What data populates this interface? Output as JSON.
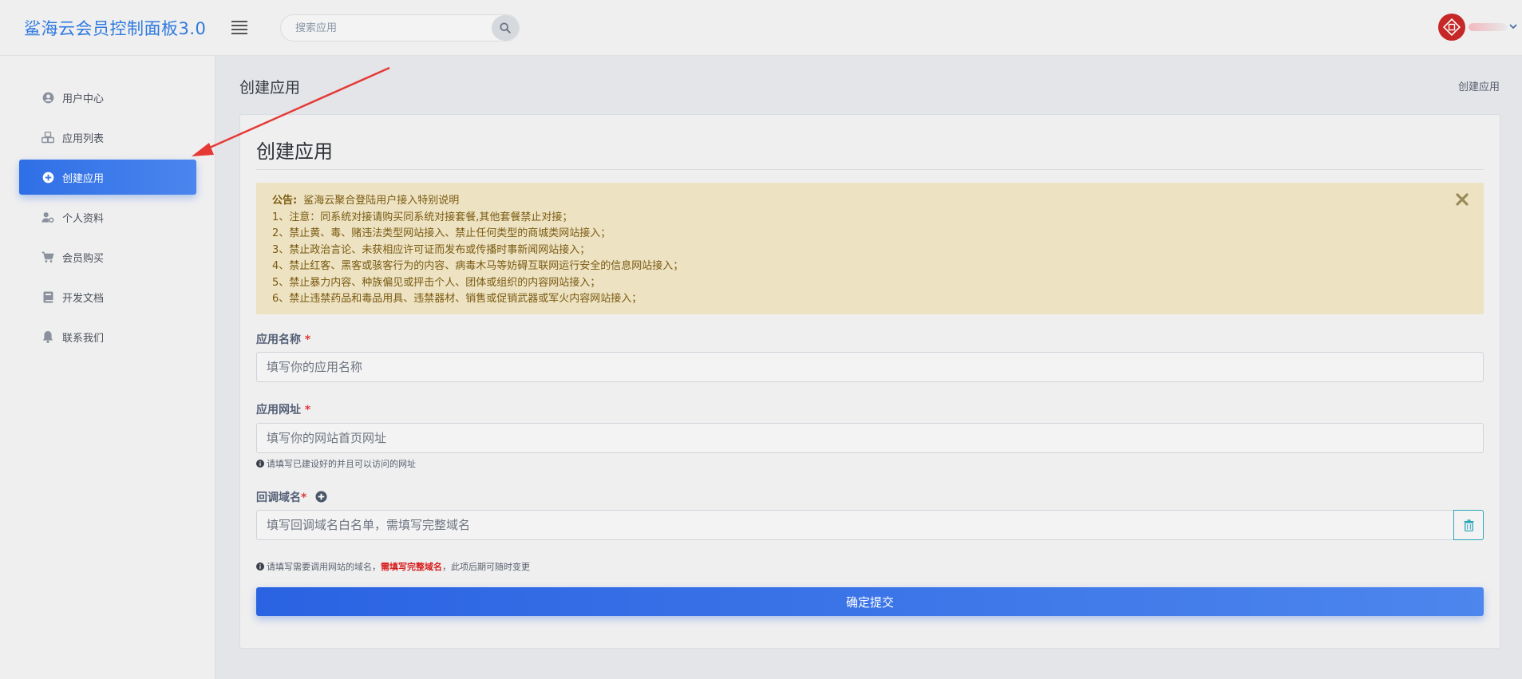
{
  "header": {
    "brand": "鲨海云会员控制面板3.0",
    "search_placeholder": "搜索应用"
  },
  "sidebar": {
    "items": [
      {
        "label": "用户中心",
        "icon": "user-circle-icon"
      },
      {
        "label": "应用列表",
        "icon": "cubes-icon"
      },
      {
        "label": "创建应用",
        "icon": "plus-circle-icon",
        "active": true
      },
      {
        "label": "个人资料",
        "icon": "user-gear-icon"
      },
      {
        "label": "会员购买",
        "icon": "cart-icon"
      },
      {
        "label": "开发文档",
        "icon": "book-icon"
      },
      {
        "label": "联系我们",
        "icon": "bell-icon"
      }
    ]
  },
  "page": {
    "title": "创建应用",
    "breadcrumb": "创建应用"
  },
  "card": {
    "title": "创建应用"
  },
  "notice": {
    "head": "公告:",
    "head_text": "鲨海云聚合登陆用户接入特别说明",
    "lines": [
      "1、注意：同系统对接请购买同系统对接套餐,其他套餐禁止对接；",
      "2、禁止黄、毒、赌违法类型网站接入、禁止任何类型的商城类网站接入；",
      "3、禁止政治言论、未获相应许可证而发布或传播时事新闻网站接入；",
      "4、禁止红客、黑客或骇客行为的内容、病毒木马等妨碍互联网运行安全的信息网站接入；",
      "5、禁止暴力内容、种族偏见或抨击个人、团体或组织的内容网站接入；",
      "6、禁止违禁药品和毒品用具、违禁器材、销售或促销武器或军火内容网站接入；"
    ]
  },
  "form": {
    "app_name": {
      "label": "应用名称",
      "required": "*",
      "placeholder": "填写你的应用名称",
      "value": ""
    },
    "app_url": {
      "label": "应用网址",
      "required": "*",
      "placeholder": "填写你的网站首页网址",
      "value": "",
      "help": "请填写已建设好的并且可以访问的网址"
    },
    "callback": {
      "label": "回调域名",
      "required": "*",
      "placeholder": "填写回调域名白名单，需填写完整域名",
      "value": "",
      "help_prefix": "请填写需要调用网站的域名，",
      "help_red": "需填写完整域名",
      "help_suffix": "，此项后期可随时变更"
    },
    "submit_label": "确定提交"
  },
  "colors": {
    "brand": "#2f79e0",
    "accent": "#2f6fe6",
    "notice_bg": "#ede3c3",
    "required": "#e03a3a"
  }
}
